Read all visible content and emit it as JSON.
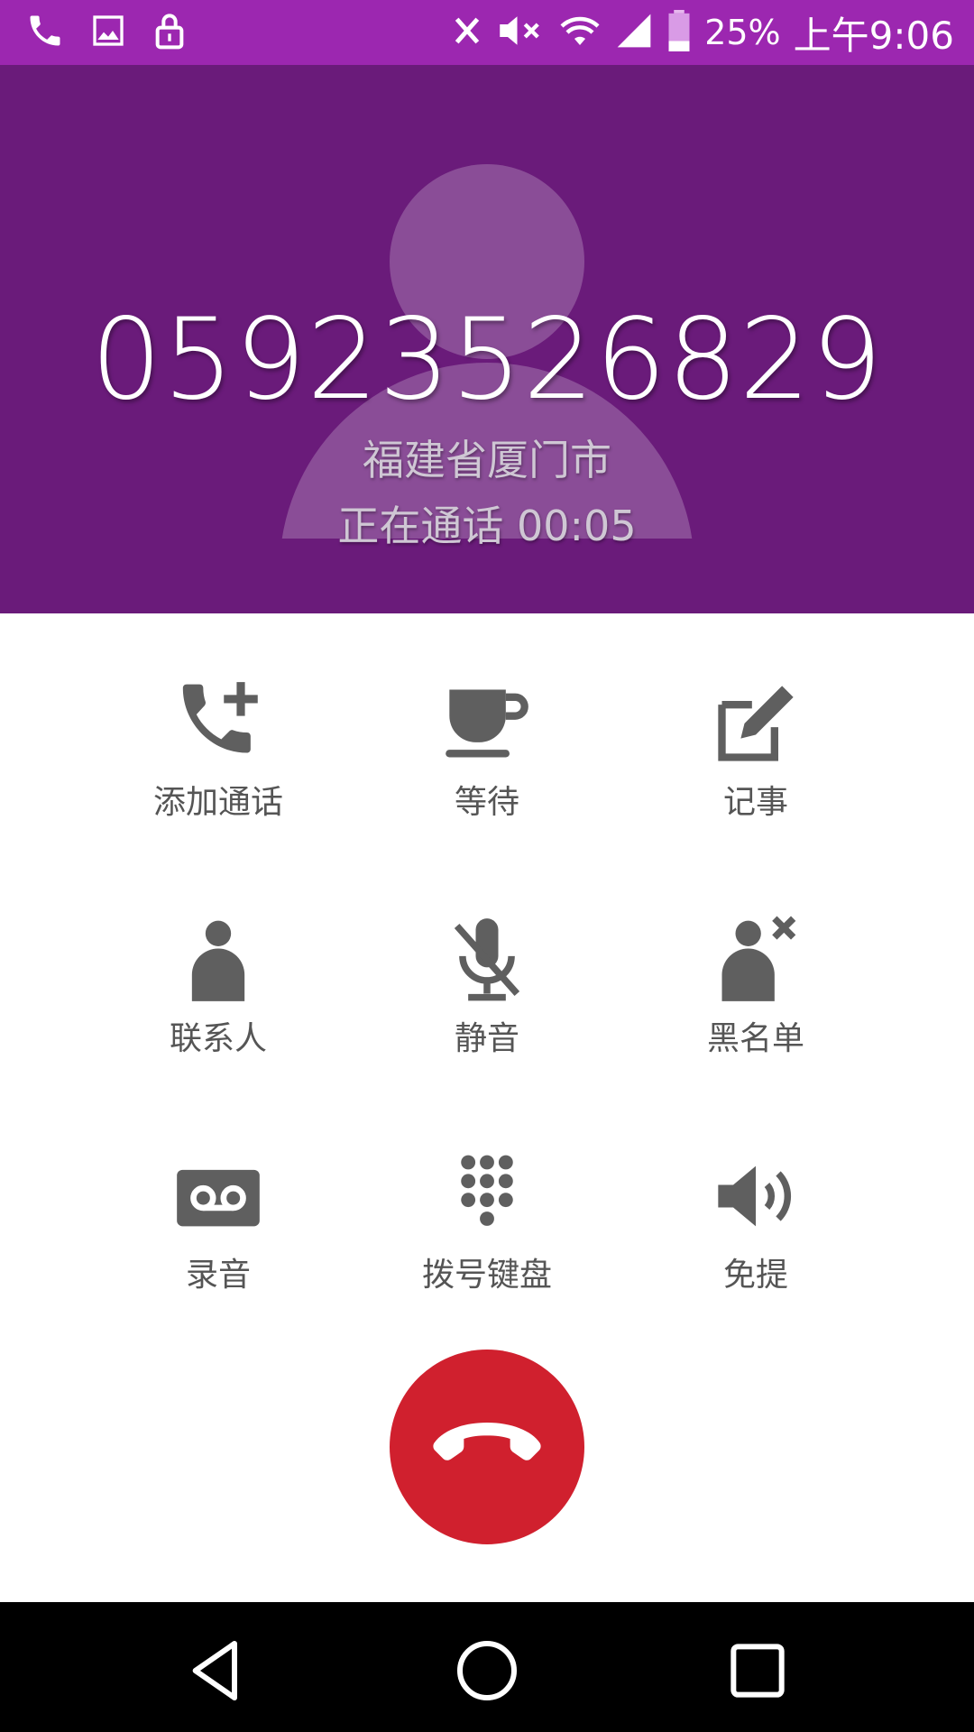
{
  "status_bar": {
    "left_icons": [
      "phone-icon",
      "image-icon",
      "lock-icon"
    ],
    "right_icons": [
      "x-icon",
      "mute-icon",
      "wifi-icon",
      "signal-icon",
      "battery-icon"
    ],
    "battery_percent": "25%",
    "time": "上午9:06",
    "color": "#9c27b0"
  },
  "call": {
    "number": "05923526829",
    "location": "福建省厦门市",
    "status": "正在通话 00:05",
    "header_color": "#6a1b7a"
  },
  "actions": [
    {
      "label": "添加通话",
      "icon": "add-call-icon"
    },
    {
      "label": "等待",
      "icon": "hold-cup-icon"
    },
    {
      "label": "记事",
      "icon": "note-edit-icon"
    },
    {
      "label": "联系人",
      "icon": "contact-person-icon"
    },
    {
      "label": "静音",
      "icon": "mic-off-icon"
    },
    {
      "label": "黑名单",
      "icon": "blacklist-person-icon"
    },
    {
      "label": "录音",
      "icon": "voicemail-record-icon"
    },
    {
      "label": "拨号键盘",
      "icon": "dialpad-icon"
    },
    {
      "label": "免提",
      "icon": "speaker-icon"
    }
  ],
  "end_call": {
    "icon": "end-call-icon",
    "color": "#d0202e"
  },
  "nav": {
    "buttons": [
      "back-icon",
      "home-icon",
      "recents-icon"
    ]
  }
}
